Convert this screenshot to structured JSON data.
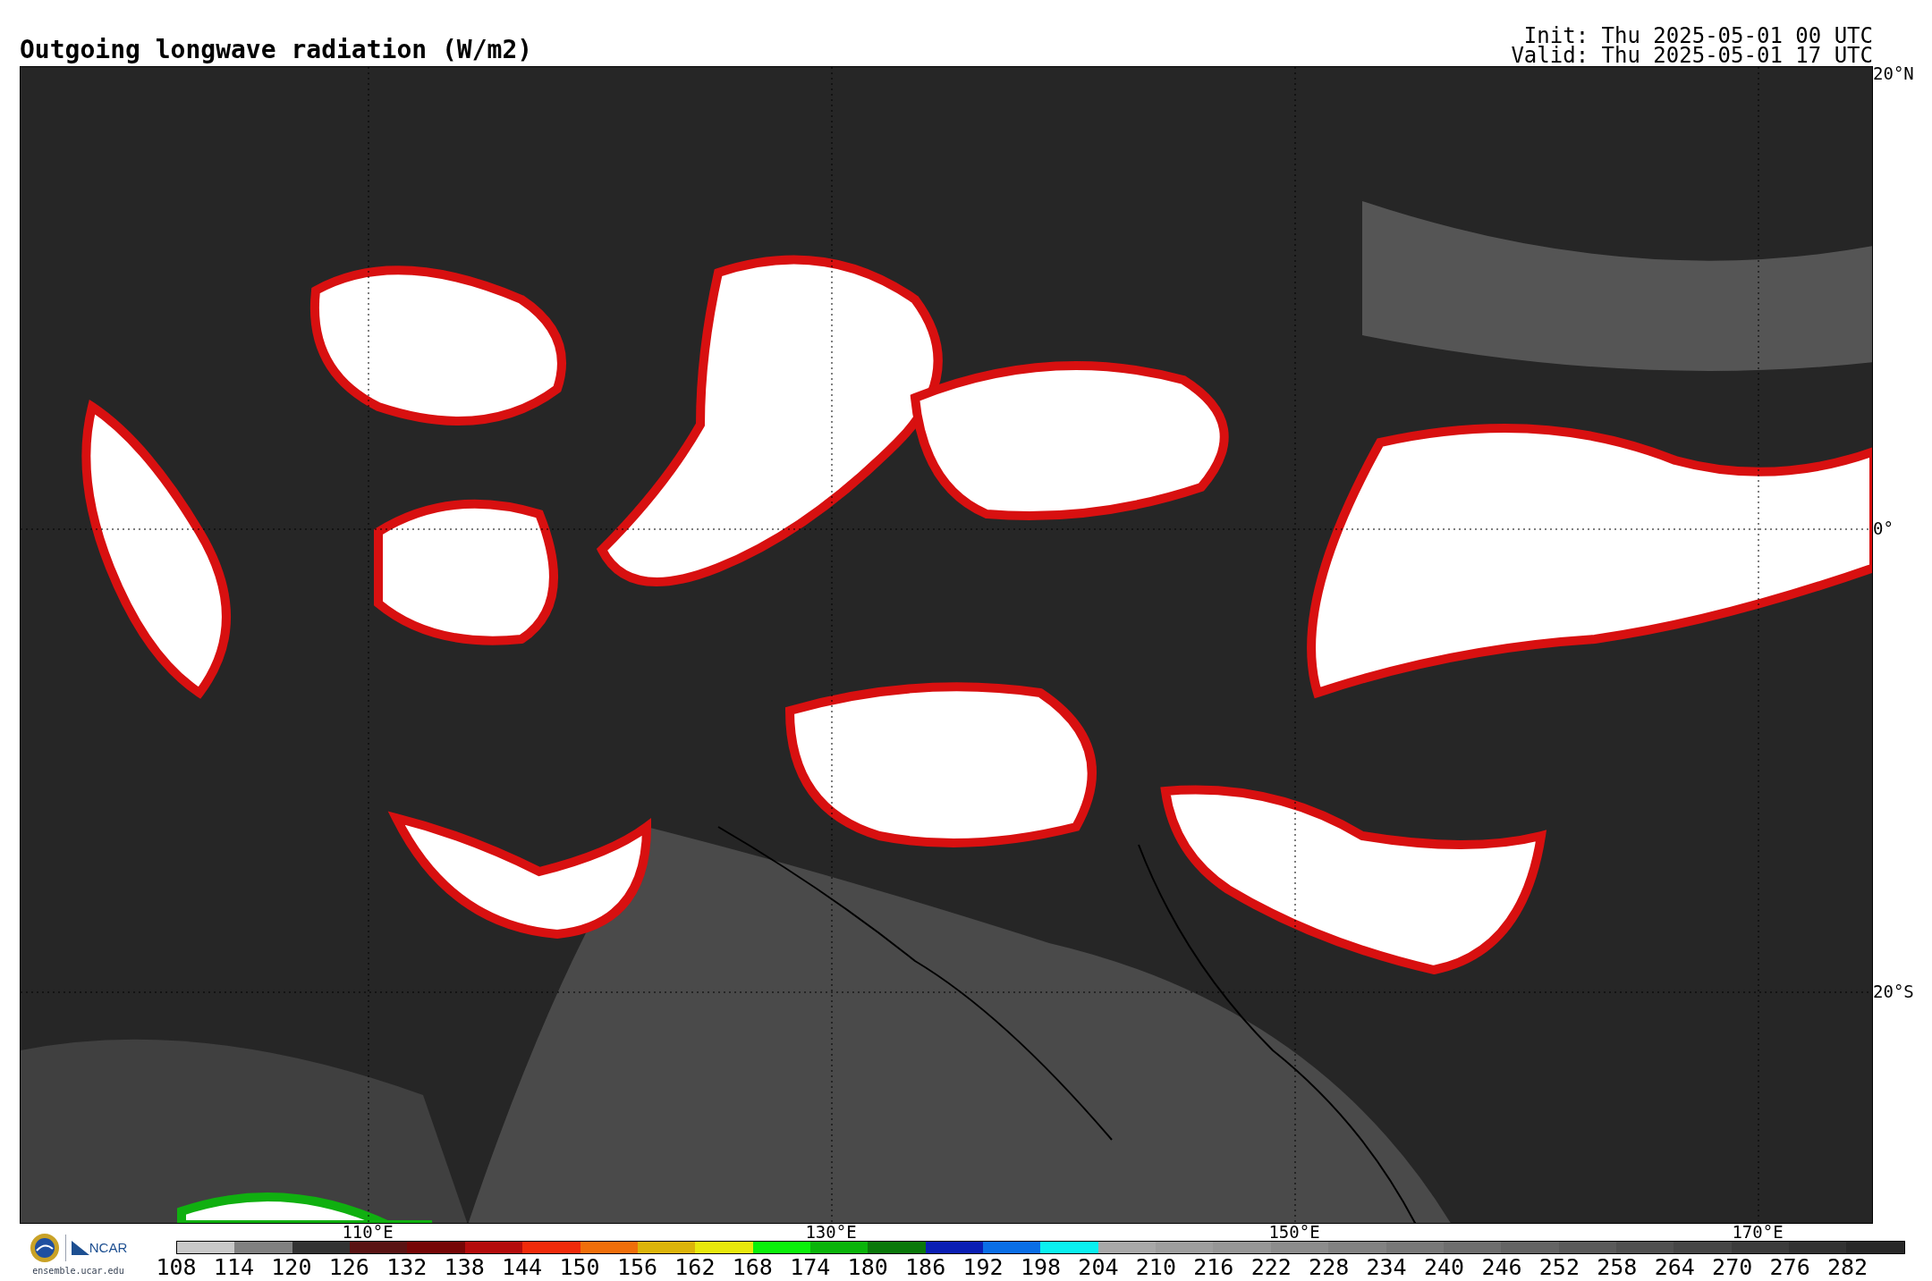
{
  "title": "Outgoing longwave radiation (W/m2)",
  "init": "Init: Thu 2025-05-01 00 UTC",
  "valid": "Valid: Thu 2025-05-01 17 UTC",
  "map": {
    "lat_labels": [
      "20°N",
      "0°",
      "20°S"
    ],
    "lon_labels": [
      "110°E",
      "130°E",
      "150°E",
      "170°E"
    ]
  },
  "logo": {
    "name": "NCAR",
    "url": "ensemble.ucar.edu"
  },
  "colorbar": [
    {
      "label": "108",
      "color": "#c8c8c8"
    },
    {
      "label": "114",
      "color": "#808080"
    },
    {
      "label": "120",
      "color": "#333333"
    },
    {
      "label": "126",
      "color": "#5a1414"
    },
    {
      "label": "132",
      "color": "#760606"
    },
    {
      "label": "138",
      "color": "#b40c0c"
    },
    {
      "label": "144",
      "color": "#f02a0a"
    },
    {
      "label": "150",
      "color": "#f06e0a"
    },
    {
      "label": "156",
      "color": "#dcb40a"
    },
    {
      "label": "162",
      "color": "#e8e80c"
    },
    {
      "label": "168",
      "color": "#0af00a"
    },
    {
      "label": "174",
      "color": "#0ab40a"
    },
    {
      "label": "180",
      "color": "#0a780a"
    },
    {
      "label": "186",
      "color": "#0a1eb4"
    },
    {
      "label": "192",
      "color": "#0a6ee6"
    },
    {
      "label": "198",
      "color": "#0af0f0"
    },
    {
      "label": "204",
      "color": "#a8a8a8"
    },
    {
      "label": "210",
      "color": "#9e9e9e"
    },
    {
      "label": "216",
      "color": "#969696"
    },
    {
      "label": "222",
      "color": "#8c8c8c"
    },
    {
      "label": "228",
      "color": "#828282"
    },
    {
      "label": "234",
      "color": "#787878"
    },
    {
      "label": "240",
      "color": "#6e6e6e"
    },
    {
      "label": "246",
      "color": "#646464"
    },
    {
      "label": "252",
      "color": "#5a5a5a"
    },
    {
      "label": "258",
      "color": "#505050"
    },
    {
      "label": "264",
      "color": "#464646"
    },
    {
      "label": "270",
      "color": "#3c3c3c"
    },
    {
      "label": "276",
      "color": "#323232"
    },
    {
      "label": "282",
      "color": "#282828"
    }
  ]
}
